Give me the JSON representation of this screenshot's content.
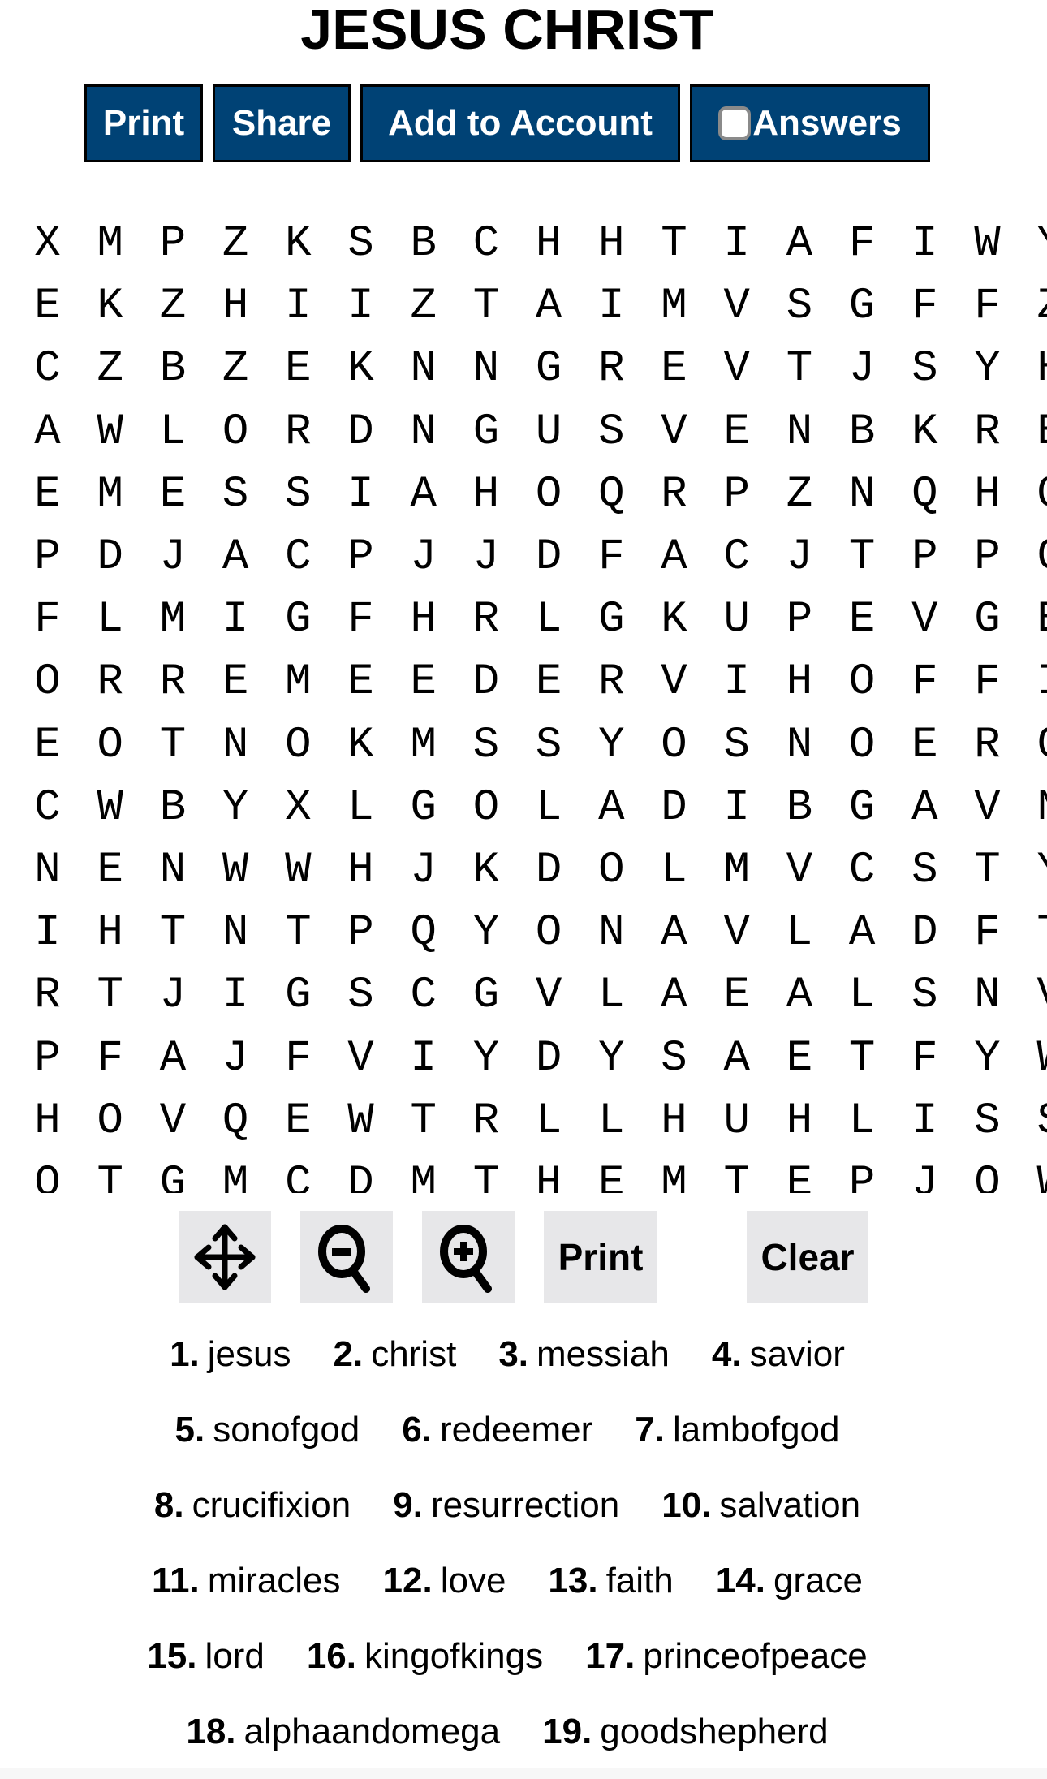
{
  "title": "JESUS CHRIST",
  "buttons": {
    "print": "Print",
    "share": "Share",
    "add_to_account": "Add to Account",
    "answers": "Answers",
    "answers_checked": false
  },
  "colors": {
    "button_bg": "#004275",
    "toolbar_bg": "#e7e7e9"
  },
  "grid": [
    [
      "X",
      "M",
      "P",
      "Z",
      "K",
      "S",
      "B",
      "C",
      "H",
      "H",
      "T",
      "I",
      "A",
      "F",
      "I",
      "W",
      "Y"
    ],
    [
      "E",
      "K",
      "Z",
      "H",
      "I",
      "I",
      "Z",
      "T",
      "A",
      "I",
      "M",
      "V",
      "S",
      "G",
      "F",
      "F",
      "Z"
    ],
    [
      "C",
      "Z",
      "B",
      "Z",
      "E",
      "K",
      "N",
      "N",
      "G",
      "R",
      "E",
      "V",
      "T",
      "J",
      "S",
      "Y",
      "H"
    ],
    [
      "A",
      "W",
      "L",
      "O",
      "R",
      "D",
      "N",
      "G",
      "U",
      "S",
      "V",
      "E",
      "N",
      "B",
      "K",
      "R",
      "E"
    ],
    [
      "E",
      "M",
      "E",
      "S",
      "S",
      "I",
      "A",
      "H",
      "O",
      "Q",
      "R",
      "P",
      "Z",
      "N",
      "Q",
      "H",
      "O"
    ],
    [
      "P",
      "D",
      "J",
      "A",
      "C",
      "P",
      "J",
      "J",
      "D",
      "F",
      "A",
      "C",
      "J",
      "T",
      "P",
      "P",
      "C"
    ],
    [
      "F",
      "L",
      "M",
      "I",
      "G",
      "F",
      "H",
      "R",
      "L",
      "G",
      "K",
      "U",
      "P",
      "E",
      "V",
      "G",
      "E"
    ],
    [
      "O",
      "R",
      "R",
      "E",
      "M",
      "E",
      "E",
      "D",
      "E",
      "R",
      "V",
      "I",
      "H",
      "O",
      "F",
      "F",
      "I"
    ],
    [
      "E",
      "O",
      "T",
      "N",
      "O",
      "K",
      "M",
      "S",
      "S",
      "Y",
      "O",
      "S",
      "N",
      "O",
      "E",
      "R",
      "C"
    ],
    [
      "C",
      "W",
      "B",
      "Y",
      "X",
      "L",
      "G",
      "O",
      "L",
      "A",
      "D",
      "I",
      "B",
      "G",
      "A",
      "V",
      "N"
    ],
    [
      "N",
      "E",
      "N",
      "W",
      "W",
      "H",
      "J",
      "K",
      "D",
      "O",
      "L",
      "M",
      "V",
      "C",
      "S",
      "T",
      "Y"
    ],
    [
      "I",
      "H",
      "T",
      "N",
      "T",
      "P",
      "Q",
      "Y",
      "O",
      "N",
      "A",
      "V",
      "L",
      "A",
      "D",
      "F",
      "T"
    ],
    [
      "R",
      "T",
      "J",
      "I",
      "G",
      "S",
      "C",
      "G",
      "V",
      "L",
      "A",
      "E",
      "A",
      "L",
      "S",
      "N",
      "V"
    ],
    [
      "P",
      "F",
      "A",
      "J",
      "F",
      "V",
      "I",
      "Y",
      "D",
      "Y",
      "S",
      "A",
      "E",
      "T",
      "F",
      "Y",
      "W"
    ],
    [
      "H",
      "O",
      "V",
      "Q",
      "E",
      "W",
      "T",
      "R",
      "L",
      "L",
      "H",
      "U",
      "H",
      "L",
      "I",
      "S",
      "S"
    ],
    [
      "O",
      "T",
      "G",
      "M",
      "C",
      "D",
      "M",
      "T",
      "H",
      "E",
      "M",
      "T",
      "E",
      "P",
      "J",
      "O",
      "W"
    ]
  ],
  "toolbar": {
    "move_icon": "move-arrows-icon",
    "zoom_out_icon": "zoom-out-icon",
    "zoom_in_icon": "zoom-in-icon",
    "print": "Print",
    "clear": "Clear"
  },
  "word_rows": [
    [
      {
        "num": "1.",
        "word": "jesus"
      },
      {
        "num": "2.",
        "word": "christ"
      },
      {
        "num": "3.",
        "word": "messiah"
      },
      {
        "num": "4.",
        "word": "savior"
      }
    ],
    [
      {
        "num": "5.",
        "word": "sonofgod"
      },
      {
        "num": "6.",
        "word": "redeemer"
      },
      {
        "num": "7.",
        "word": "lambofgod"
      }
    ],
    [
      {
        "num": "8.",
        "word": "crucifixion"
      },
      {
        "num": "9.",
        "word": "resurrection"
      },
      {
        "num": "10.",
        "word": "salvation"
      }
    ],
    [
      {
        "num": "11.",
        "word": "miracles"
      },
      {
        "num": "12.",
        "word": "love"
      },
      {
        "num": "13.",
        "word": "faith"
      },
      {
        "num": "14.",
        "word": "grace"
      }
    ],
    [
      {
        "num": "15.",
        "word": "lord"
      },
      {
        "num": "16.",
        "word": "kingofkings"
      },
      {
        "num": "17.",
        "word": "princeofpeace"
      }
    ],
    [
      {
        "num": "18.",
        "word": "alphaandomega"
      },
      {
        "num": "19.",
        "word": "goodshepherd"
      }
    ]
  ]
}
